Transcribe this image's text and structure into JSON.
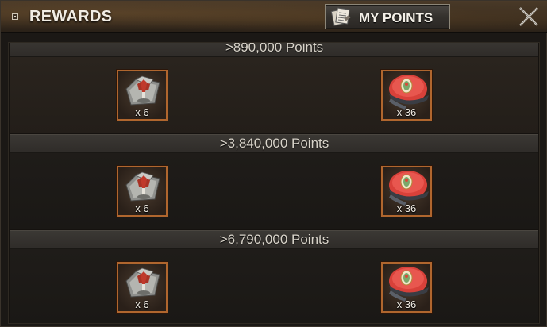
{
  "header": {
    "title": "REWARDS",
    "my_points_label": "MY POINTS"
  },
  "tiers": [
    {
      "threshold": ">890,000 Points",
      "rewards": [
        {
          "icon": "medal-badge-icon",
          "qty": "x 6"
        },
        {
          "icon": "red-beret-icon",
          "qty": "x 36"
        }
      ]
    },
    {
      "threshold": ">3,840,000 Points",
      "rewards": [
        {
          "icon": "medal-badge-icon",
          "qty": "x 6"
        },
        {
          "icon": "red-beret-icon",
          "qty": "x 36"
        }
      ]
    },
    {
      "threshold": ">6,790,000 Points",
      "rewards": [
        {
          "icon": "medal-badge-icon",
          "qty": "x 6"
        },
        {
          "icon": "red-beret-icon",
          "qty": "x 36"
        }
      ]
    }
  ],
  "colors": {
    "item_border": "#b0662e",
    "header_bg": "#3a2d1f"
  }
}
